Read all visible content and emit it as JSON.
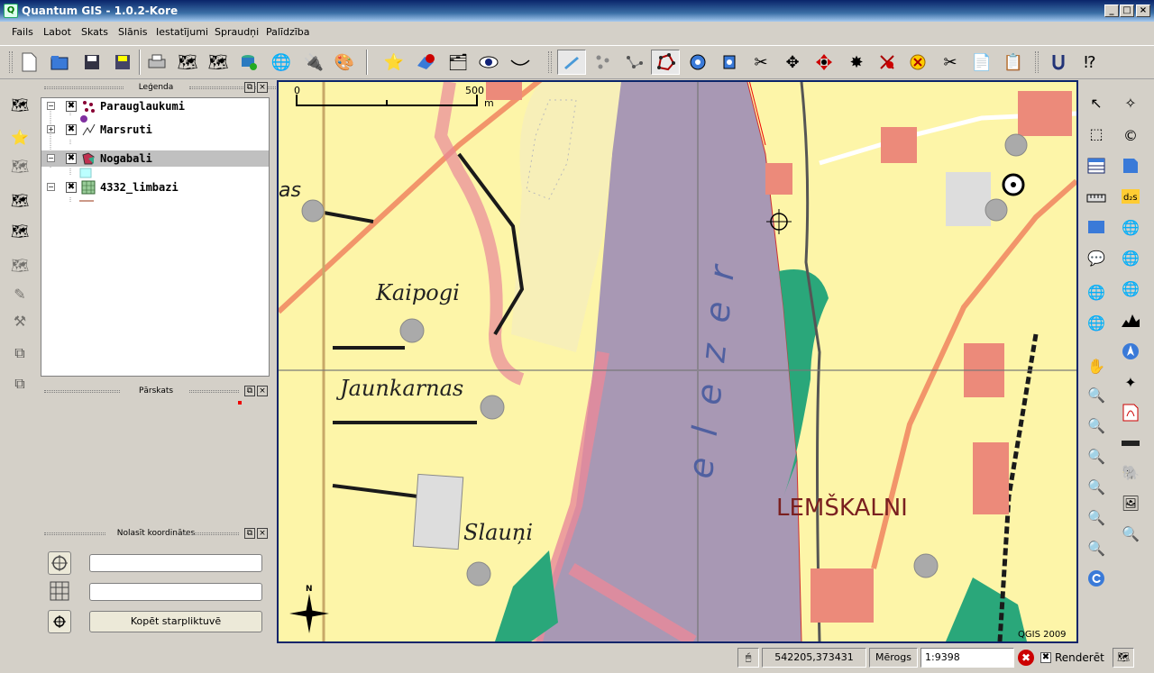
{
  "window": {
    "title": "Quantum GIS - 1.0.2-Kore",
    "icon": "qgis-icon"
  },
  "menu": [
    "Fails",
    "Labot",
    "Skats",
    "Slānis",
    "Iestatījumi",
    "Spraudņi",
    "Palīdzība"
  ],
  "legend": {
    "title": "Leģenda",
    "layers": [
      {
        "name": "Parauglaukumi",
        "checked": "✖",
        "icon": "point-layer-icon"
      },
      {
        "name": "Marsruti",
        "checked": "✖",
        "icon": "line-layer-icon"
      },
      {
        "name": "Nogabali",
        "checked": "✖",
        "icon": "polygon-layer-icon"
      },
      {
        "name": "4332_limbazi",
        "checked": "✖",
        "icon": "raster-layer-icon"
      }
    ]
  },
  "overview": {
    "title": "Pārskats"
  },
  "coords_panel": {
    "title": "Nolasīt koordinātes",
    "field1": "",
    "field2": "",
    "copy_label": "Kopēt starpliktuvē"
  },
  "map": {
    "scalebar": {
      "start": "0",
      "end": "500",
      "unit": "m"
    },
    "labels": {
      "kaipogi": "Kaipogi",
      "jaunkarnas": "Jaunkarnas",
      "slauni": "Slauņi",
      "lemskalni": "LEMŠKALNI",
      "lake": "e  l  e  z  e  r",
      "partial": "as"
    },
    "copyright": "QGIS 2009",
    "north": "N",
    "colors": {
      "water": "#a898b4",
      "land": "#fdf5a8",
      "forest": "#2aa77a",
      "building": "#ec8a7a",
      "road": "#f2956a"
    }
  },
  "status": {
    "coordinates": "542205,373431",
    "scale_label": "Mērogs",
    "scale_value": "1:9398",
    "render_label": "Renderēt",
    "render_checked": "✖"
  }
}
